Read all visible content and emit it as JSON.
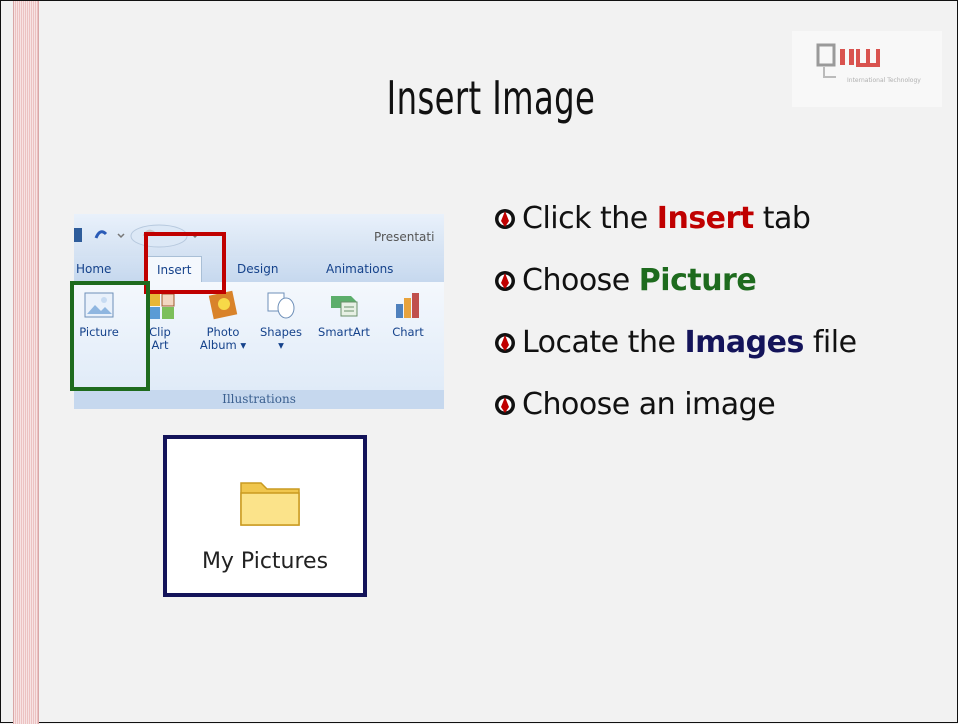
{
  "slide": {
    "title": "Insert Image",
    "logo": {
      "tagline": "International Technology"
    }
  },
  "ribbon": {
    "window_title": "Presentati",
    "tabs": [
      "Home",
      "Insert",
      "Design",
      "Animations"
    ],
    "active_tab": "Insert",
    "buttons": [
      {
        "label": "Picture",
        "icon": "picture-icon"
      },
      {
        "label": "Clip\nArt",
        "icon": "clip-art-icon"
      },
      {
        "label": "Photo\nAlbum ▾",
        "icon": "photo-album-icon"
      },
      {
        "label": "Shapes\n▾",
        "icon": "shapes-icon"
      },
      {
        "label": "SmartArt",
        "icon": "smartart-icon"
      },
      {
        "label": "Chart",
        "icon": "chart-icon"
      }
    ],
    "group_label": "Illustrations",
    "highlight_colors": {
      "insert_tab": "#c00000",
      "picture_button": "#1e6b1e"
    }
  },
  "folder": {
    "label": "My Pictures",
    "icon": "folder-icon",
    "border_color": "#14145a"
  },
  "bullets": [
    {
      "pre": "Click the ",
      "keyword": "Insert",
      "post": " tab",
      "color": "#c00000"
    },
    {
      "pre": "Choose ",
      "keyword": "Picture",
      "post": "",
      "color": "#1e6b1e"
    },
    {
      "pre": "Locate the ",
      "keyword": "Images",
      "post": " file",
      "color": "#14145a"
    },
    {
      "pre": "Choose an image",
      "keyword": "",
      "post": "",
      "color": "#111111"
    }
  ]
}
